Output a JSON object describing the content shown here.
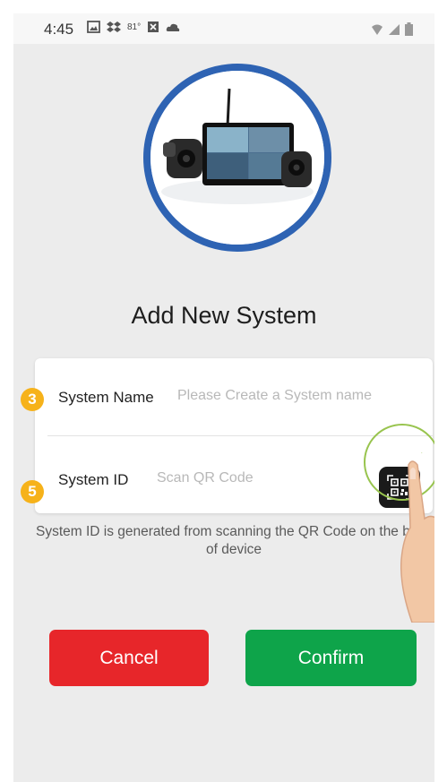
{
  "status_bar": {
    "time": "4:45",
    "temperature": "81°"
  },
  "hero_image": {
    "alt": "Camera system"
  },
  "page_title": "Add New System",
  "form": {
    "system_name": {
      "step": "3",
      "label": "System Name",
      "placeholder": "Please Create a System name",
      "value": ""
    },
    "system_id": {
      "step": "5",
      "label": "System ID",
      "placeholder": "Scan QR Code",
      "value": ""
    },
    "qr_icon": "qr-code-icon"
  },
  "help_text": "System ID is generated from scanning the QR Code on the back of device",
  "buttons": {
    "cancel": "Cancel",
    "confirm": "Confirm"
  },
  "colors": {
    "accent_blue": "#2e63b3",
    "cancel_red": "#e7262a",
    "confirm_green": "#0ea44a",
    "badge_orange": "#f6b21a"
  }
}
